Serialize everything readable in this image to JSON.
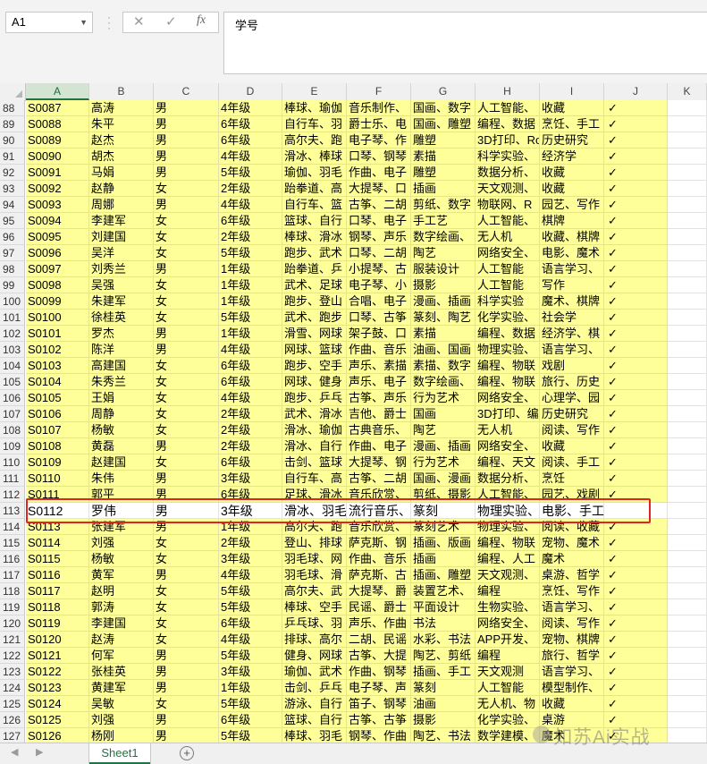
{
  "formula_bar": {
    "name_box": "A1",
    "cancel_icon": "✕",
    "enter_icon": "✓",
    "function_label": "fx",
    "content": "学号"
  },
  "columns": [
    "A",
    "B",
    "C",
    "D",
    "E",
    "F",
    "G",
    "H",
    "I",
    "J",
    "K"
  ],
  "selected_column": "A",
  "rows": [
    {
      "num": "88",
      "cells": [
        "S0087",
        "高涛",
        "男",
        "4年级",
        "棒球、瑜伽",
        "音乐制作、",
        "国画、数字",
        "人工智能、",
        "收藏",
        "✓"
      ]
    },
    {
      "num": "89",
      "cells": [
        "S0088",
        "朱平",
        "男",
        "6年级",
        "自行车、羽",
        "爵士乐、电",
        "国画、雕塑",
        "编程、数据",
        "烹饪、手工",
        "✓"
      ]
    },
    {
      "num": "90",
      "cells": [
        "S0089",
        "赵杰",
        "男",
        "6年级",
        "高尔夫、跑",
        "电子琴、作",
        "雕塑",
        "3D打印、Ro",
        "历史研究",
        "✓"
      ]
    },
    {
      "num": "91",
      "cells": [
        "S0090",
        "胡杰",
        "男",
        "4年级",
        "滑冰、棒球",
        "口琴、钢琴",
        "素描",
        "科学实验、",
        "经济学",
        "✓"
      ]
    },
    {
      "num": "92",
      "cells": [
        "S0091",
        "马娟",
        "男",
        "5年级",
        "瑜伽、羽毛",
        "作曲、电子",
        "雕塑",
        "数据分析、",
        "收藏",
        "✓"
      ]
    },
    {
      "num": "93",
      "cells": [
        "S0092",
        "赵静",
        "女",
        "2年级",
        "跆拳道、高",
        "大提琴、口",
        "插画",
        "天文观测、",
        "收藏",
        "✓"
      ]
    },
    {
      "num": "94",
      "cells": [
        "S0093",
        "周娜",
        "男",
        "4年级",
        "自行车、篮",
        "古筝、二胡",
        "剪纸、数字",
        "物联网、R",
        "园艺、写作",
        "✓"
      ]
    },
    {
      "num": "95",
      "cells": [
        "S0094",
        "李建军",
        "女",
        "6年级",
        "篮球、自行",
        "口琴、电子",
        "手工艺",
        "人工智能、",
        "棋牌",
        "✓"
      ]
    },
    {
      "num": "96",
      "cells": [
        "S0095",
        "刘建国",
        "女",
        "2年级",
        "棒球、滑冰",
        "钢琴、声乐",
        "数字绘画、",
        "无人机",
        "收藏、棋牌",
        "✓"
      ]
    },
    {
      "num": "97",
      "cells": [
        "S0096",
        "吴洋",
        "女",
        "5年级",
        "跑步、武术",
        "口琴、二胡",
        "陶艺",
        "网络安全、",
        "电影、魔术",
        "✓"
      ]
    },
    {
      "num": "98",
      "cells": [
        "S0097",
        "刘秀兰",
        "男",
        "1年级",
        "跆拳道、乒",
        "小提琴、古",
        "服装设计",
        "人工智能",
        "语言学习、",
        "✓"
      ]
    },
    {
      "num": "99",
      "cells": [
        "S0098",
        "吴强",
        "女",
        "1年级",
        "武术、足球",
        "电子琴、小",
        "摄影",
        "人工智能",
        "写作",
        "✓"
      ]
    },
    {
      "num": "100",
      "cells": [
        "S0099",
        "朱建军",
        "女",
        "1年级",
        "跑步、登山",
        "合唱、电子",
        "漫画、插画",
        "科学实验",
        "魔术、棋牌",
        "✓"
      ]
    },
    {
      "num": "101",
      "cells": [
        "S0100",
        "徐桂英",
        "女",
        "5年级",
        "武术、跑步",
        "口琴、古筝",
        "篆刻、陶艺",
        "化学实验、",
        "社会学",
        "✓"
      ]
    },
    {
      "num": "102",
      "cells": [
        "S0101",
        "罗杰",
        "男",
        "1年级",
        "滑雪、网球",
        "架子鼓、口",
        "素描",
        "编程、数据",
        "经济学、棋",
        "✓"
      ]
    },
    {
      "num": "103",
      "cells": [
        "S0102",
        "陈洋",
        "男",
        "4年级",
        "网球、篮球",
        "作曲、音乐",
        "油画、国画",
        "物理实验、",
        "语言学习、",
        "✓"
      ]
    },
    {
      "num": "104",
      "cells": [
        "S0103",
        "高建国",
        "女",
        "6年级",
        "跑步、空手",
        "声乐、素描",
        "素描、数字",
        "编程、物联",
        "戏剧",
        "✓"
      ]
    },
    {
      "num": "105",
      "cells": [
        "S0104",
        "朱秀兰",
        "女",
        "6年级",
        "网球、健身",
        "声乐、电子",
        "数字绘画、",
        "编程、物联",
        "旅行、历史",
        "✓"
      ]
    },
    {
      "num": "106",
      "cells": [
        "S0105",
        "王娟",
        "女",
        "4年级",
        "跑步、乒乓",
        "古筝、声乐",
        "行为艺术",
        "网络安全、",
        "心理学、园",
        "✓"
      ]
    },
    {
      "num": "107",
      "cells": [
        "S0106",
        "周静",
        "女",
        "2年级",
        "武术、滑冰",
        "吉他、爵士",
        "国画",
        "3D打印、编",
        "历史研究",
        "✓"
      ]
    },
    {
      "num": "108",
      "cells": [
        "S0107",
        "杨敏",
        "女",
        "2年级",
        "滑冰、瑜伽",
        "古典音乐、",
        "陶艺",
        "无人机",
        "阅读、写作",
        "✓"
      ]
    },
    {
      "num": "109",
      "cells": [
        "S0108",
        "黄磊",
        "男",
        "2年级",
        "滑冰、自行",
        "作曲、电子",
        "漫画、插画",
        "网络安全、",
        "收藏",
        "✓"
      ]
    },
    {
      "num": "110",
      "cells": [
        "S0109",
        "赵建国",
        "女",
        "6年级",
        "击剑、篮球",
        "大提琴、钢",
        "行为艺术",
        "编程、天文",
        "阅读、手工",
        "✓"
      ]
    },
    {
      "num": "111",
      "cells": [
        "S0110",
        "朱伟",
        "男",
        "3年级",
        "自行车、高",
        "古筝、二胡",
        "国画、漫画",
        "数据分析、",
        "烹饪",
        "✓"
      ]
    },
    {
      "num": "112",
      "cells": [
        "S0111",
        "郭平",
        "男",
        "6年级",
        "足球、滑冰",
        "音乐欣赏、",
        "剪纸、摄影",
        "人工智能、",
        "园艺、戏剧",
        "✓"
      ]
    },
    {
      "num": "113",
      "cells": [
        "S0112",
        "罗伟",
        "男",
        "3年级",
        "滑冰、羽毛",
        "流行音乐、",
        "篆刻",
        "物理实验、",
        "电影、手工DIY",
        ""
      ],
      "highlight": true
    },
    {
      "num": "114",
      "cells": [
        "S0113",
        "张建军",
        "男",
        "1年级",
        "高尔夫、跑",
        "音乐欣赏、",
        "篆刻艺术",
        "物理实验、",
        "阅读、收藏",
        "✓"
      ]
    },
    {
      "num": "115",
      "cells": [
        "S0114",
        "刘强",
        "女",
        "2年级",
        "登山、排球",
        "萨克斯、钢",
        "插画、版画",
        "编程、物联",
        "宠物、魔术",
        "✓"
      ]
    },
    {
      "num": "116",
      "cells": [
        "S0115",
        "杨敏",
        "女",
        "3年级",
        "羽毛球、网",
        "作曲、音乐",
        "插画",
        "编程、人工",
        "魔术",
        "✓"
      ]
    },
    {
      "num": "117",
      "cells": [
        "S0116",
        "黄军",
        "男",
        "4年级",
        "羽毛球、滑",
        "萨克斯、古",
        "插画、雕塑",
        "天文观测、",
        "桌游、哲学",
        "✓"
      ]
    },
    {
      "num": "118",
      "cells": [
        "S0117",
        "赵明",
        "女",
        "5年级",
        "高尔夫、武",
        "大提琴、爵",
        "装置艺术、",
        "编程",
        "烹饪、写作",
        "✓"
      ]
    },
    {
      "num": "119",
      "cells": [
        "S0118",
        "郭涛",
        "女",
        "5年级",
        "棒球、空手",
        "民谣、爵士",
        "平面设计",
        "生物实验、",
        "语言学习、",
        "✓"
      ]
    },
    {
      "num": "120",
      "cells": [
        "S0119",
        "李建国",
        "女",
        "6年级",
        "乒乓球、羽",
        "声乐、作曲",
        "书法",
        "网络安全、",
        "阅读、写作",
        "✓"
      ]
    },
    {
      "num": "121",
      "cells": [
        "S0120",
        "赵涛",
        "女",
        "4年级",
        "排球、高尔",
        "二胡、民谣",
        "水彩、书法",
        "APP开发、",
        "宠物、棋牌",
        "✓"
      ]
    },
    {
      "num": "122",
      "cells": [
        "S0121",
        "何军",
        "男",
        "5年级",
        "健身、网球",
        "古筝、大提",
        "陶艺、剪纸",
        "编程",
        "旅行、哲学",
        "✓"
      ]
    },
    {
      "num": "123",
      "cells": [
        "S0122",
        "张桂英",
        "男",
        "3年级",
        "瑜伽、武术",
        "作曲、钢琴",
        "插画、手工",
        "天文观测",
        "语言学习、",
        "✓"
      ]
    },
    {
      "num": "124",
      "cells": [
        "S0123",
        "黄建军",
        "男",
        "1年级",
        "击剑、乒乓",
        "电子琴、声",
        "篆刻",
        "人工智能",
        "模型制作、",
        "✓"
      ]
    },
    {
      "num": "125",
      "cells": [
        "S0124",
        "吴敏",
        "女",
        "5年级",
        "游泳、自行",
        "笛子、钢琴",
        "油画",
        "无人机、物",
        "收藏",
        "✓"
      ]
    },
    {
      "num": "126",
      "cells": [
        "S0125",
        "刘强",
        "男",
        "6年级",
        "篮球、自行",
        "古筝、古筝",
        "摄影",
        "化学实验、",
        "桌游",
        "✓"
      ]
    },
    {
      "num": "127",
      "cells": [
        "S0126",
        "杨刚",
        "男",
        "5年级",
        "棒球、羽毛",
        "钢琴、作曲",
        "陶艺、书法",
        "数学建模、",
        "魔术",
        "✓"
      ]
    }
  ],
  "sheet_tab": "Sheet1",
  "add_sheet_icon": "+",
  "watermark": "如苏Ai实战"
}
